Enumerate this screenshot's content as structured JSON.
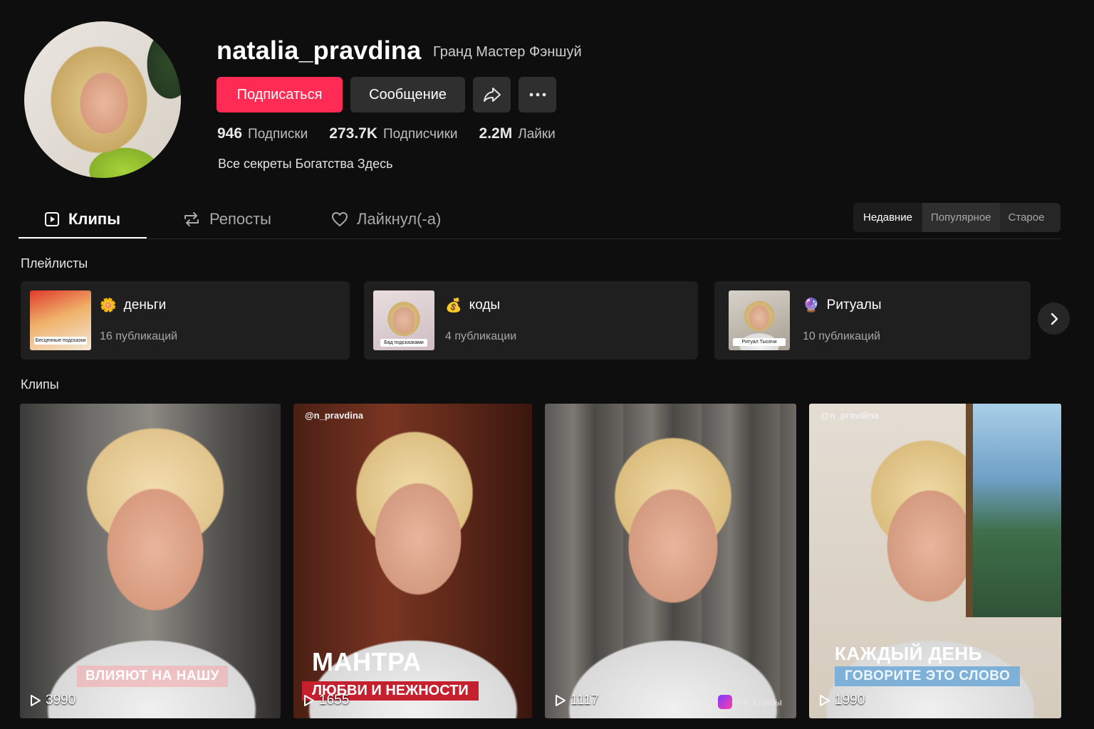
{
  "profile": {
    "username": "natalia_pravdina",
    "subtitle": "Гранд Мастер Фэншуй",
    "follow_label": "Подписаться",
    "message_label": "Сообщение",
    "stats": [
      {
        "value": "946",
        "label": "Подписки"
      },
      {
        "value": "273.7K",
        "label": "Подписчики"
      },
      {
        "value": "2.2M",
        "label": "Лайки"
      }
    ],
    "bio": "Все секреты Богатства Здесь"
  },
  "tabs": [
    {
      "label": "Клипы",
      "icon": "play-square-icon",
      "active": true
    },
    {
      "label": "Репосты",
      "icon": "repost-icon",
      "active": false
    },
    {
      "label": "Лайкнул(-а)",
      "icon": "heart-icon",
      "active": false
    }
  ],
  "sort": {
    "options": [
      "Недавние",
      "Популярное",
      "Старое"
    ],
    "selected": "Недавние"
  },
  "playlists_title": "Плейлисты",
  "playlists": [
    {
      "emoji": "🌼",
      "name": "деньги",
      "count": "16 публикаций",
      "thumb_caption": "Бесценные подсказки"
    },
    {
      "emoji": "💰",
      "name": "коды",
      "count": "4 публикации",
      "thumb_caption": "Бад подсказками"
    },
    {
      "emoji": "🔮",
      "name": "Ритуалы",
      "count": "10 публикаций",
      "thumb_caption": "Ритуал Тысячи"
    }
  ],
  "clips_title": "Клипы",
  "clips": [
    {
      "plays": "3990",
      "handle": "",
      "overlay": "ВЛИЯЮТ НА НАШУ"
    },
    {
      "plays": "1655",
      "handle": "@n_pravdina",
      "overlay_big": "МАНТРА",
      "overlay": "ЛЮБВИ И НЕЖНОСТИ"
    },
    {
      "plays": "1117",
      "handle": "",
      "badge": "VK Клипы"
    },
    {
      "plays": "1990",
      "handle": "@n_pravdina",
      "overlay_big": "КАЖДЫЙ ДЕНЬ",
      "overlay": "ГОВОРИТЕ ЭТО СЛОВО"
    }
  ],
  "colors": {
    "accent": "#fe2c55",
    "background": "#0e0e0e",
    "surface": "#1f1f1f"
  }
}
